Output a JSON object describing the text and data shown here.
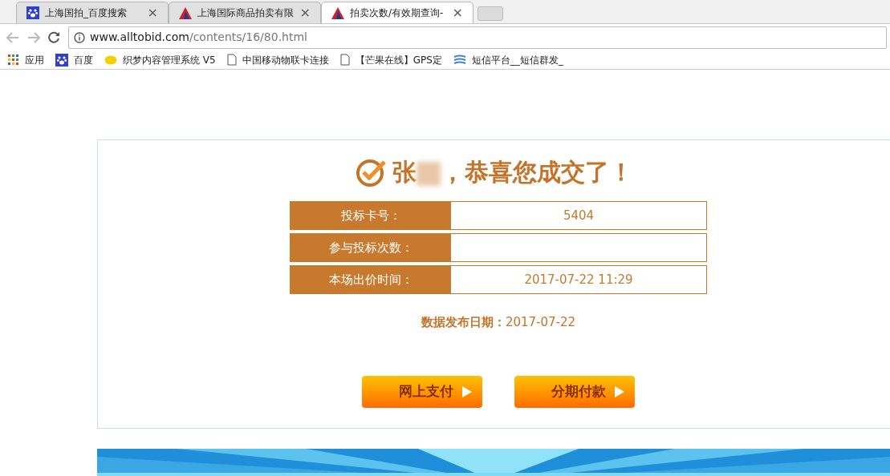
{
  "tabs": [
    {
      "title": "上海国拍_百度搜索",
      "kind": "paw",
      "close": "×",
      "selected": false
    },
    {
      "title": "上海国际商品拍卖有限",
      "kind": "triangle",
      "close": "×",
      "selected": false
    },
    {
      "title": "拍卖次数/有效期查询-",
      "kind": "triangle",
      "close": "×",
      "selected": true
    }
  ],
  "address_bar": {
    "host": "www.alltobid.com",
    "path": "/contents/16/80.html"
  },
  "bookmarks": [
    {
      "label": "应用",
      "kind": "apps"
    },
    {
      "label": "百度",
      "kind": "paw"
    },
    {
      "label": "织梦内容管理系统 V5",
      "kind": "lemon"
    },
    {
      "label": "中国移动物联卡连接",
      "kind": "page"
    },
    {
      "label": "【芒果在线】GPS定",
      "kind": "page"
    },
    {
      "label": "短信平台__短信群发_",
      "kind": "sms"
    }
  ],
  "result": {
    "name": "张",
    "heading": "，恭喜您成交了！",
    "rows": [
      {
        "label": "投标卡号：",
        "value": "5404"
      },
      {
        "label": "参与投标次数："
      },
      {
        "label": "本场出价时间：",
        "value": "2017-07-22 11:29"
      }
    ],
    "date_label": "数据发布日期：",
    "date": "2017-07-22",
    "buttons": [
      "网上支付",
      "分期付款"
    ]
  }
}
